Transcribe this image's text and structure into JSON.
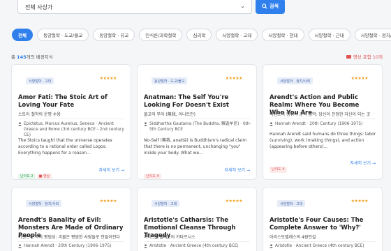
{
  "search": {
    "select_value": "전체 사상가",
    "button_label": "검색"
  },
  "chips": [
    "전체",
    "동양철학 · 도교/불교",
    "동양철학 · 유교",
    "인식론/과학철학",
    "심리학",
    "서양철학 · 고대",
    "서양철학 · 현대",
    "서양철학 · 근대",
    "서양철학 · 정치/사회"
  ],
  "summary": {
    "prefix": "총 ",
    "count": "145",
    "suffix": "개의 배경지식",
    "video_label": "영상 포함 10개"
  },
  "cards": [
    {
      "tag": "서양철학 · 고대",
      "stars": "★★★★★",
      "title": "Amor Fati: The Stoic Art of Loving Your Fate",
      "ko": "스토아 철학의 운명 수용",
      "author": "Epictetus, Marcus Aurelius, Seneca · Ancient Greece and Rome (3rd century BCE - 2nd century CE)",
      "desc": "The Stoics taught that the universe operates according to a rational order called Logos. Everything happens for a reason...",
      "level": "난이도 2",
      "video": "영상",
      "more": "자세히 보기 →"
    },
    {
      "tag": "동양철학 · 도교/불교",
      "stars": "★★★★★",
      "title": "Anatman: The Self You're Looking For Doesn't Exist",
      "ko": "불교의 무아 (無我, 아나트만)",
      "author": "Siddhartha Gautama (The Buddha, 釋迦牟尼) · 6th-5th Century BCE",
      "desc": "No-Self (無我, anattā) is Buddhism's radical claim that there is no permanent, unchanging \"you\" inside your body. What we...",
      "level": "난이도 4",
      "more": "자세히 보기 →"
    },
    {
      "tag": "서양철학 · 정치/사회",
      "stars": "★★★★★",
      "title": "Arendt's Action and Public Realm: Where You Become Who You Are",
      "ko": "아렌트의 행위와 공적 영역: 당신이 진정한 자신이 되는 곳",
      "author": "Hannah Arendt · 20th Century (1906-1975)",
      "desc": "Hannah Arendt said humans do three things: labor (surviving), work (making things), and action (appearing before others)...",
      "level": "난이도 4",
      "more": "자세히 보기 →"
    },
    {
      "tag": "서양철학 · 정치/사회",
      "stars": "★★★★★",
      "title": "Arendt's Banality of Evil: Monsters Are Made of Ordinary People",
      "ko": "아렌트의 악의 평범성: 괴물은 평범한 사람들로 만들어진다",
      "author": "Hannah Arendt · 20th Century (1906-1975)"
    },
    {
      "tag": "서양철학 · 고대",
      "stars": "★★★★★",
      "title": "Aristotle's Catharsis: The Emotional Cleanse Through Tragedy",
      "ko": "아리스토텔레스의 카타르시스",
      "author": "Aristotle · Ancient Greece (4th century BCE)"
    },
    {
      "tag": "서양철학 · 고대",
      "stars": "★★★★★",
      "title": "Aristotle's Four Causes: The Complete Answer to 'Why?'",
      "ko": "아리스토텔레스의 4원인설",
      "author": "Aristotle · Ancient Greece (4th century BCE)"
    }
  ]
}
